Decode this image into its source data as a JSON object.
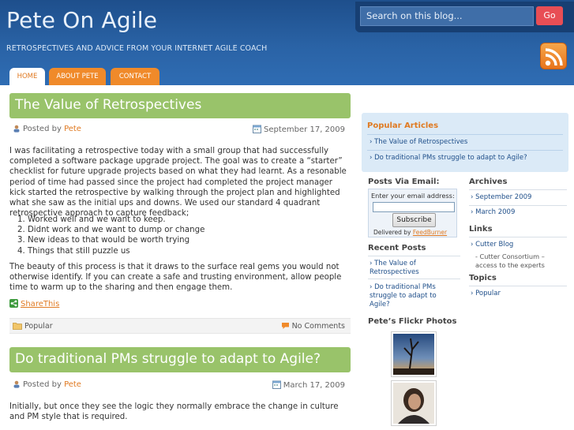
{
  "site": {
    "title": "Pete On Agile",
    "tagline": "RETROSPECTIVES AND ADVICE FROM YOUR INTERNET AGILE COACH"
  },
  "search": {
    "placeholder": "Search on this blog...",
    "button": "Go"
  },
  "nav": {
    "home": "HOME",
    "about": "ABOUT PETE",
    "contact": "CONTACT"
  },
  "posts": [
    {
      "title": "The Value of Retrospectives",
      "posted_by": "Posted by",
      "author": "Pete",
      "date": "September 17, 2009",
      "p1": "I was facilitating a retrospective today with a small group that had successfully completed a software package upgrade project. The goal was to create a “starter” checklist for future upgrade projects based on what they had learnt. As a resonable period of time had passed since the project had completed the project manager kick started the retrospective by walking through the project plan and highlighted what she saw as the initial ups and downs. We used our standard 4 quadrant retrospective approach to capture feedback;",
      "list": [
        "1.  Worked well and we want to keep.",
        "2.  Didnt work and we want to dump or change",
        "3.  New ideas to that would be worth trying",
        "4.  Things that still puzzle us"
      ],
      "p2": "The beauty of this process is that it draws to the surface real gems you would not otherwise identify. If you can create a safe and trusting environment, allow people time to warm up to the sharing and then engage them.",
      "share": "ShareThis",
      "category": "Popular",
      "comments": "No Comments"
    },
    {
      "title": "Do traditional PMs struggle to adapt to Agile?",
      "posted_by": "Posted by",
      "author": "Pete",
      "date": "March 17, 2009",
      "p1": "Initially, but once they see the logic they normally embrace the change in culture and PM style that is required."
    }
  ],
  "sidebar": {
    "popular_title": "Popular Articles",
    "popular": [
      "The Value of Retrospectives",
      "Do traditional PMs struggle to adapt to Agile?"
    ],
    "email_title": "Posts Via Email:",
    "email_label": "Enter your email address:",
    "subscribe": "Subscribe",
    "delivered_by": "Delivered by",
    "feedburner": "FeedBurner",
    "recent_title": "Recent Posts",
    "recent": [
      "The Value of Retrospectives",
      "Do traditional PMs struggle to adapt to Agile?"
    ],
    "flickr_title": "Pete’s Flickr Photos",
    "archives_title": "Archives",
    "archives": [
      "September 2009",
      "March 2009"
    ],
    "links_title": "Links",
    "link_cutter": "Cutter Blog",
    "link_consortium": "- Cutter Consortium – access to the experts",
    "topics_title": "Topics",
    "topics": [
      "Popular"
    ]
  },
  "colors": {
    "header_blue": "#2f6db4",
    "accent_orange": "#e07a22",
    "title_green": "#99c36a",
    "go_red": "#e84e55",
    "sidebar_blue": "#dbeaf7"
  },
  "icons": [
    "rss-icon",
    "user-icon",
    "calendar-icon",
    "share-icon",
    "folder-icon",
    "comment-icon"
  ]
}
